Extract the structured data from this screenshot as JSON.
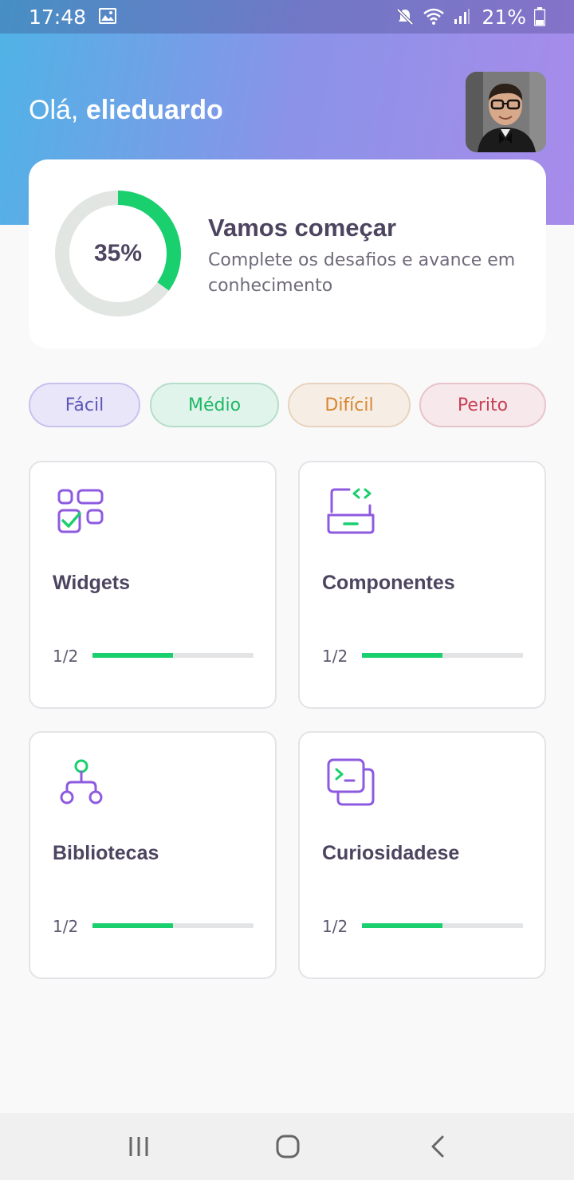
{
  "status_bar": {
    "time": "17:48",
    "battery": "21%",
    "icons": [
      "image-icon",
      "mute-icon",
      "wifi-icon",
      "signal-icon",
      "battery-icon"
    ]
  },
  "header": {
    "greeting": "Olá,",
    "username": "elieduardo",
    "gradient_colors": [
      "#4FB3E6",
      "#A88BEA"
    ]
  },
  "progress_card": {
    "percent_label": "35%",
    "percent_value": 35,
    "title": "Vamos começar",
    "subtitle": "Complete os desafios e avance em conhecimento",
    "ring_color": "#19CF6E",
    "ring_track_color": "#E2E6E3"
  },
  "filters": [
    {
      "label": "Fácil"
    },
    {
      "label": "Médio"
    },
    {
      "label": "Difícil"
    },
    {
      "label": "Perito"
    }
  ],
  "categories": [
    {
      "title": "Widgets",
      "count": "1/2",
      "progress": 0.5,
      "icon": "widgets-icon"
    },
    {
      "title": "Componentes",
      "count": "1/2",
      "progress": 0.5,
      "icon": "laptop-code-icon"
    },
    {
      "title": "Bibliotecas",
      "count": "1/2",
      "progress": 0.5,
      "icon": "hierarchy-icon"
    },
    {
      "title": "Curiosidadese",
      "count": "1/2",
      "progress": 0.5,
      "icon": "terminal-icon"
    }
  ],
  "accent_colors": {
    "icon_purple": "#8E5AE0",
    "icon_green": "#19CF6E",
    "progress_green": "#19CF6E"
  },
  "nav_bar": {
    "buttons": [
      "recent-apps-icon",
      "home-icon",
      "back-icon"
    ]
  }
}
